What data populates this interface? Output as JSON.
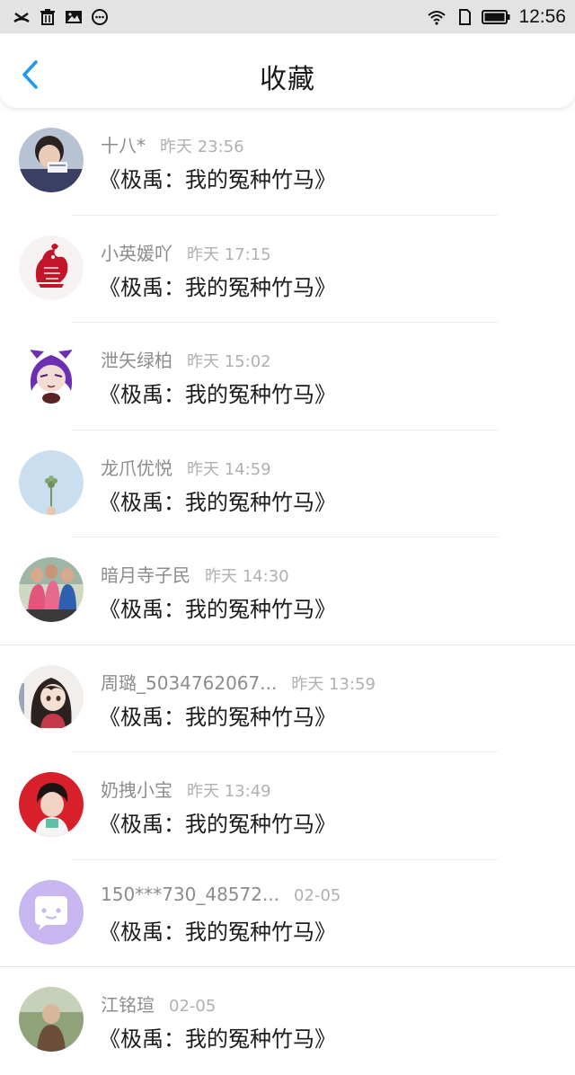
{
  "status_bar": {
    "time": "12:56",
    "colors": {
      "background": "#e3e3e3",
      "icon": "#111111"
    },
    "left_icons": [
      "missed-call-icon",
      "trash-icon",
      "image-icon",
      "more-dots-icon"
    ],
    "right_icons": [
      "wifi-icon",
      "sim-icon",
      "battery-icon"
    ]
  },
  "header": {
    "title": "收藏",
    "back_icon": "chevron-left-icon",
    "colors": {
      "accent": "#1e9bf0"
    }
  },
  "favorites": [
    {
      "user": "十八*",
      "time": "昨天 23:56",
      "title": "《极禹：我的冤种竹马》",
      "avatar": "person-photo-avatar"
    },
    {
      "user": "小英媛吖",
      "time": "昨天 17:15",
      "title": "《极禹：我的冤种竹马》",
      "avatar": "red-rooster-papercut-avatar"
    },
    {
      "user": "泄矢绿柏",
      "time": "昨天 15:02",
      "title": "《极禹：我的冤种竹马》",
      "avatar": "anime-purple-hair-avatar"
    },
    {
      "user": "龙爪优悦",
      "time": "昨天 14:59",
      "title": "《极禹：我的冤种竹马》",
      "avatar": "sky-flower-avatar"
    },
    {
      "user": "暗月寺子民",
      "time": "昨天 14:30",
      "title": "《极禹：我的冤种竹马》",
      "avatar": "group-photo-avatar"
    },
    {
      "user": "周璐_5034762067...",
      "time": "昨天 13:59",
      "title": "《极禹：我的冤种竹马》",
      "avatar": "anime-girl-avatar"
    },
    {
      "user": "奶拽小宝",
      "time": "昨天 13:49",
      "title": "《极禹：我的冤种竹马》",
      "avatar": "red-background-avatar"
    },
    {
      "user": "150***730_48572...",
      "time": "02-05",
      "title": "《极禹：我的冤种竹马》",
      "avatar": "default-chat-bubble-avatar"
    },
    {
      "user": "江铭瑄",
      "time": "02-05",
      "title": "《极禹：我的冤种竹马》",
      "avatar": "outdoor-photo-avatar"
    }
  ]
}
